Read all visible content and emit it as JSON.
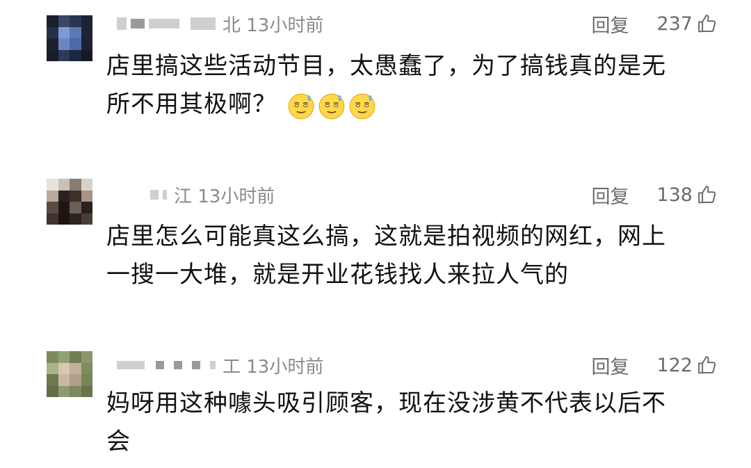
{
  "comments": [
    {
      "location": "北 13小时前",
      "reply_label": "回复",
      "likes": "237",
      "text_lines": [
        "店里搞这些活动节目，太愚蠢了，为了搞钱真的是无",
        "所不用其极啊？"
      ],
      "emojis": [
        "sweat-smile-emoji",
        "sweat-smile-emoji",
        "sweat-smile-emoji"
      ],
      "avatar_colors": [
        "#1a2030",
        "#3a4766",
        "#2b3450",
        "#1c2232",
        "#243049",
        "#7f9bd6",
        "#5c77b4",
        "#1d2336",
        "#1b2131",
        "#6d86c2",
        "#4a6aa8",
        "#1c2232",
        "#181d2a",
        "#2d3a5a",
        "#1f2740",
        "#151a26"
      ]
    },
    {
      "location": "江 13小时前",
      "reply_label": "回复",
      "likes": "138",
      "text_lines": [
        "店里怎么可能真这么搞，这就是拍视频的网红，网上",
        "一搜一大堆，就是开业花钱找人来拉人气的"
      ],
      "emojis": [],
      "avatar_colors": [
        "#e7e2dc",
        "#c9bfb6",
        "#8a7c72",
        "#d9d2cb",
        "#b8a99c",
        "#2b2220",
        "#3c302b",
        "#a59487",
        "#5a4b45",
        "#1e1614",
        "#6e5d55",
        "#2a201d",
        "#3f3330",
        "#1b1412",
        "#2c2320",
        "#4a3d38"
      ]
    },
    {
      "location": "工 13小时前",
      "reply_label": "回复",
      "likes": "122",
      "text_lines": [
        "妈呀用这种噱头吸引顾客，现在没涉黄不代表以后不",
        "会"
      ],
      "emojis": [],
      "avatar_colors": [
        "#7c8a5e",
        "#93a072",
        "#6f7f55",
        "#8a976b",
        "#a8b486",
        "#d8c7b4",
        "#c2b09a",
        "#7e8c62",
        "#6b7a50",
        "#cbb8a3",
        "#b39e88",
        "#768658",
        "#5f6e47",
        "#8c9a6e",
        "#7b8a5d",
        "#65744b"
      ]
    }
  ]
}
